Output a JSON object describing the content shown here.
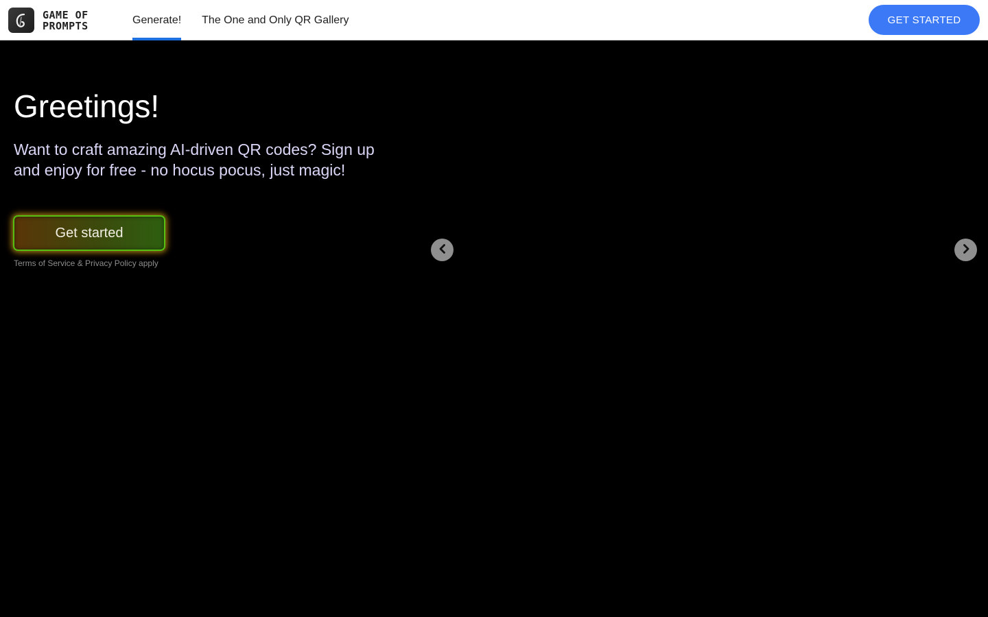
{
  "header": {
    "logo_line1": "GAME OF",
    "logo_line2": "PROMPTS",
    "nav": [
      {
        "label": "Generate!",
        "active": true
      },
      {
        "label": "The One and Only QR Gallery",
        "active": false
      }
    ],
    "cta_label": "GET STARTED"
  },
  "hero": {
    "title": "Greetings!",
    "subtitle": "Want to craft amazing AI-driven QR codes? Sign up and enjoy for free - no hocus pocus, just magic!",
    "button_label": "Get started",
    "terms": "Terms of Service & Privacy Policy apply"
  },
  "carousel": {
    "prev_icon": "chevron-left-icon",
    "next_icon": "chevron-right-icon"
  },
  "colors": {
    "accent": "#3c79f6",
    "nav_underline": "#1e6fe0",
    "background": "#000000",
    "glow_orange": "#ff8214",
    "glow_green": "#56c012"
  }
}
